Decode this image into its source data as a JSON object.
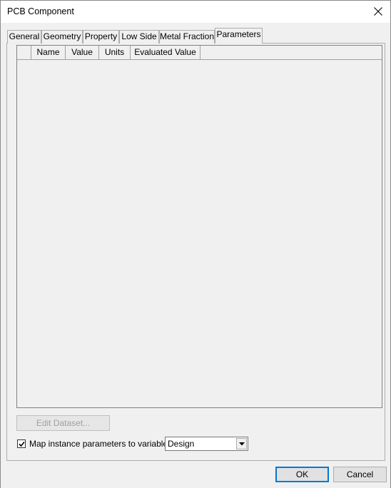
{
  "window": {
    "title": "PCB Component"
  },
  "tabs": [
    {
      "label": "General"
    },
    {
      "label": "Geometry"
    },
    {
      "label": "Property"
    },
    {
      "label": "Low Side"
    },
    {
      "label": "Metal Fraction"
    },
    {
      "label": "Parameters",
      "active": true
    }
  ],
  "grid": {
    "columns": [
      "",
      "Name",
      "Value",
      "Units",
      "Evaluated Value"
    ]
  },
  "controls": {
    "edit_dataset_label": "Edit Dataset...",
    "map_checkbox_label": "Map instance parameters to variables:",
    "map_checked": true,
    "map_select_value": "Design"
  },
  "footer": {
    "ok_label": "OK",
    "cancel_label": "Cancel"
  }
}
